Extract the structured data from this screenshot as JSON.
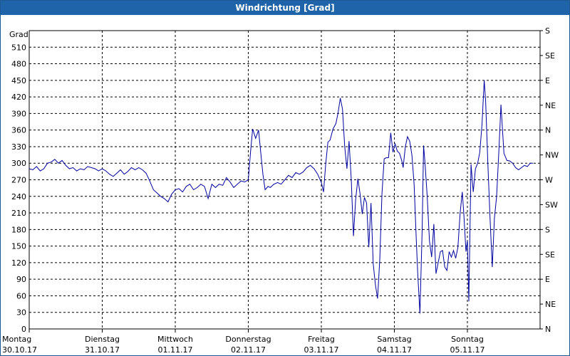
{
  "window": {
    "title": "Windrichtung [Grad]"
  },
  "chart_data": {
    "type": "line",
    "title": "Windrichtung [Grad]",
    "ylabel": "Grad",
    "ylim": [
      0,
      540
    ],
    "y_ticks": [
      0,
      30,
      60,
      90,
      120,
      150,
      180,
      210,
      240,
      270,
      300,
      330,
      360,
      390,
      420,
      450,
      480,
      510
    ],
    "y2_labels": [
      "N",
      "NE",
      "E",
      "SE",
      "S",
      "SW",
      "W",
      "NW",
      "N",
      "NE",
      "E",
      "SE",
      "S"
    ],
    "x_ticks": [
      {
        "day": "Montag",
        "date": "30.10.17"
      },
      {
        "day": "Dienstag",
        "date": "31.10.17"
      },
      {
        "day": "Mittwoch",
        "date": "01.11.17"
      },
      {
        "day": "Donnerstag",
        "date": "02.11.17"
      },
      {
        "day": "Freitag",
        "date": "03.11.17"
      },
      {
        "day": "Samstag",
        "date": "04.11.17"
      },
      {
        "day": "Sonntag",
        "date": "05.11.17"
      }
    ],
    "grid": true,
    "line_color": "#0000a0",
    "series": [
      {
        "values": [
          [
            0,
            290
          ],
          [
            0.05,
            288
          ],
          [
            0.1,
            294
          ],
          [
            0.15,
            286
          ],
          [
            0.2,
            290
          ],
          [
            0.25,
            300
          ],
          [
            0.3,
            302
          ],
          [
            0.35,
            307
          ],
          [
            0.4,
            300
          ],
          [
            0.45,
            305
          ],
          [
            0.5,
            296
          ],
          [
            0.55,
            290
          ],
          [
            0.6,
            292
          ],
          [
            0.65,
            286
          ],
          [
            0.7,
            290
          ],
          [
            0.75,
            288
          ],
          [
            0.8,
            294
          ],
          [
            0.85,
            292
          ],
          [
            0.9,
            290
          ],
          [
            0.95,
            286
          ],
          [
            1.0,
            290
          ],
          [
            1.05,
            286
          ],
          [
            1.1,
            280
          ],
          [
            1.15,
            276
          ],
          [
            1.2,
            282
          ],
          [
            1.25,
            288
          ],
          [
            1.3,
            280
          ],
          [
            1.35,
            285
          ],
          [
            1.4,
            292
          ],
          [
            1.45,
            288
          ],
          [
            1.5,
            292
          ],
          [
            1.55,
            288
          ],
          [
            1.6,
            282
          ],
          [
            1.65,
            268
          ],
          [
            1.7,
            252
          ],
          [
            1.75,
            246
          ],
          [
            1.8,
            240
          ],
          [
            1.85,
            236
          ],
          [
            1.9,
            230
          ],
          [
            1.95,
            244
          ],
          [
            2.0,
            252
          ],
          [
            2.05,
            254
          ],
          [
            2.1,
            248
          ],
          [
            2.15,
            258
          ],
          [
            2.2,
            262
          ],
          [
            2.25,
            252
          ],
          [
            2.3,
            256
          ],
          [
            2.35,
            262
          ],
          [
            2.4,
            258
          ],
          [
            2.45,
            236
          ],
          [
            2.5,
            262
          ],
          [
            2.55,
            256
          ],
          [
            2.6,
            262
          ],
          [
            2.65,
            260
          ],
          [
            2.7,
            274
          ],
          [
            2.75,
            266
          ],
          [
            2.8,
            256
          ],
          [
            2.85,
            262
          ],
          [
            2.9,
            268
          ],
          [
            2.95,
            266
          ],
          [
            3.0,
            270
          ],
          [
            3.03,
            320
          ],
          [
            3.06,
            362
          ],
          [
            3.1,
            345
          ],
          [
            3.14,
            360
          ],
          [
            3.17,
            320
          ],
          [
            3.2,
            280
          ],
          [
            3.23,
            252
          ],
          [
            3.27,
            258
          ],
          [
            3.3,
            256
          ],
          [
            3.35,
            262
          ],
          [
            3.4,
            265
          ],
          [
            3.45,
            262
          ],
          [
            3.5,
            270
          ],
          [
            3.55,
            278
          ],
          [
            3.6,
            274
          ],
          [
            3.65,
            283
          ],
          [
            3.7,
            280
          ],
          [
            3.75,
            284
          ],
          [
            3.8,
            292
          ],
          [
            3.85,
            296
          ],
          [
            3.9,
            290
          ],
          [
            3.95,
            280
          ],
          [
            4.0,
            265
          ],
          [
            4.03,
            248
          ],
          [
            4.06,
            298
          ],
          [
            4.09,
            338
          ],
          [
            4.12,
            342
          ],
          [
            4.16,
            362
          ],
          [
            4.2,
            372
          ],
          [
            4.23,
            392
          ],
          [
            4.26,
            418
          ],
          [
            4.29,
            398
          ],
          [
            4.32,
            330
          ],
          [
            4.35,
            290
          ],
          [
            4.38,
            340
          ],
          [
            4.41,
            270
          ],
          [
            4.44,
            168
          ],
          [
            4.47,
            235
          ],
          [
            4.5,
            272
          ],
          [
            4.53,
            245
          ],
          [
            4.56,
            208
          ],
          [
            4.59,
            238
          ],
          [
            4.62,
            228
          ],
          [
            4.65,
            148
          ],
          [
            4.68,
            228
          ],
          [
            4.71,
            118
          ],
          [
            4.74,
            80
          ],
          [
            4.77,
            55
          ],
          [
            4.8,
            125
          ],
          [
            4.83,
            245
          ],
          [
            4.86,
            308
          ],
          [
            4.89,
            310
          ],
          [
            4.92,
            310
          ],
          [
            4.95,
            355
          ],
          [
            4.98,
            320
          ],
          [
            5.01,
            335
          ],
          [
            5.04,
            322
          ],
          [
            5.07,
            318
          ],
          [
            5.1,
            305
          ],
          [
            5.12,
            292
          ],
          [
            5.15,
            330
          ],
          [
            5.18,
            348
          ],
          [
            5.21,
            340
          ],
          [
            5.24,
            315
          ],
          [
            5.27,
            262
          ],
          [
            5.3,
            160
          ],
          [
            5.32,
            100
          ],
          [
            5.35,
            28
          ],
          [
            5.38,
            180
          ],
          [
            5.4,
            332
          ],
          [
            5.42,
            300
          ],
          [
            5.45,
            240
          ],
          [
            5.48,
            160
          ],
          [
            5.51,
            130
          ],
          [
            5.54,
            190
          ],
          [
            5.57,
            100
          ],
          [
            5.6,
            120
          ],
          [
            5.63,
            140
          ],
          [
            5.66,
            142
          ],
          [
            5.69,
            112
          ],
          [
            5.72,
            106
          ],
          [
            5.75,
            140
          ],
          [
            5.78,
            130
          ],
          [
            5.81,
            142
          ],
          [
            5.84,
            128
          ],
          [
            5.87,
            148
          ],
          [
            5.9,
            210
          ],
          [
            5.93,
            248
          ],
          [
            5.95,
            210
          ],
          [
            5.98,
            140
          ],
          [
            6.0,
            160
          ],
          [
            6.02,
            50
          ],
          [
            6.05,
            298
          ],
          [
            6.08,
            248
          ],
          [
            6.11,
            290
          ],
          [
            6.14,
            300
          ],
          [
            6.17,
            320
          ],
          [
            6.2,
            370
          ],
          [
            6.23,
            450
          ],
          [
            6.25,
            412
          ],
          [
            6.28,
            300
          ],
          [
            6.31,
            200
          ],
          [
            6.34,
            112
          ],
          [
            6.37,
            200
          ],
          [
            6.4,
            240
          ],
          [
            6.43,
            320
          ],
          [
            6.46,
            406
          ],
          [
            6.5,
            318
          ],
          [
            6.54,
            305
          ],
          [
            6.58,
            304
          ],
          [
            6.62,
            300
          ],
          [
            6.66,
            292
          ],
          [
            6.7,
            288
          ],
          [
            6.74,
            292
          ],
          [
            6.78,
            296
          ],
          [
            6.82,
            294
          ],
          [
            6.86,
            300
          ],
          [
            6.9,
            300
          ]
        ]
      }
    ]
  }
}
